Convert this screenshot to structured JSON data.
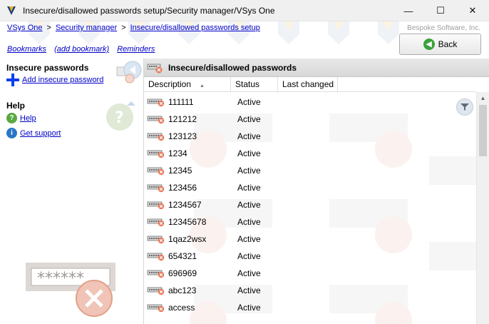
{
  "window": {
    "title": "Insecure/disallowed passwords setup/Security manager/VSys One",
    "minimize_glyph": "—",
    "maximize_glyph": "☐",
    "close_glyph": "✕"
  },
  "breadcrumb": {
    "items": [
      "VSys One",
      "Security manager",
      "Insecure/disallowed passwords setup"
    ],
    "separator": ">"
  },
  "company": "Bespoke Software, Inc.",
  "links": {
    "bookmarks": "Bookmarks",
    "add_bookmark": "(add bookmark)",
    "reminders": "Reminders"
  },
  "back_button": {
    "label": "Back"
  },
  "sidebar": {
    "section1_title": "Insecure passwords",
    "add_label": "Add insecure password",
    "section2_title": "Help",
    "help_label": "Help",
    "support_label": "Get support",
    "password_mask": "******"
  },
  "main": {
    "panel_title": "Insecure/disallowed passwords",
    "columns": {
      "description": "Description",
      "status": "Status",
      "last_changed": "Last changed"
    },
    "rows": [
      {
        "description": "111111",
        "status": "Active"
      },
      {
        "description": "121212",
        "status": "Active"
      },
      {
        "description": "123123",
        "status": "Active"
      },
      {
        "description": "1234",
        "status": "Active"
      },
      {
        "description": "12345",
        "status": "Active"
      },
      {
        "description": "123456",
        "status": "Active"
      },
      {
        "description": "1234567",
        "status": "Active"
      },
      {
        "description": "12345678",
        "status": "Active"
      },
      {
        "description": "1qaz2wsx",
        "status": "Active"
      },
      {
        "description": "654321",
        "status": "Active"
      },
      {
        "description": "696969",
        "status": "Active"
      },
      {
        "description": "abc123",
        "status": "Active"
      },
      {
        "description": "access",
        "status": "Active"
      }
    ]
  },
  "colors": {
    "link": "#0000c8",
    "add_plus": "#0a3ef0",
    "help_icon": "#5aa842",
    "info_icon": "#2a76c6",
    "deny": "#d9603c"
  }
}
